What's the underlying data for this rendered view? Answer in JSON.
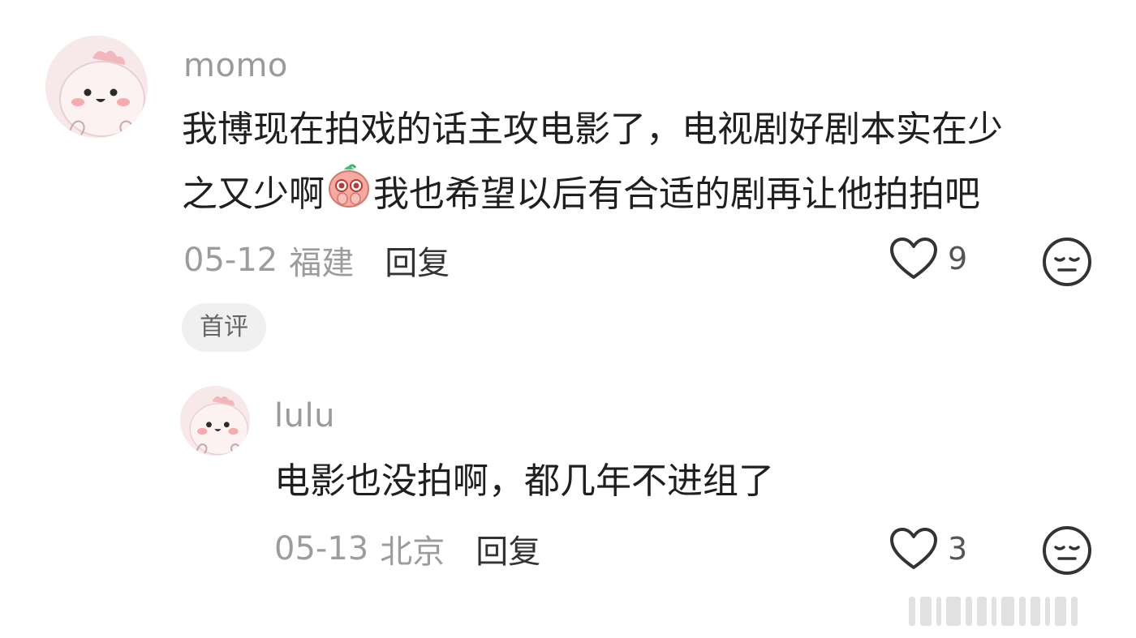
{
  "comment": {
    "username": "momo",
    "content_line1": "我博现在拍戏的话主攻电影了，电视剧好剧本实在少",
    "content_line2_a": "之又少啊",
    "content_line2_b": "我也希望以后有合适的剧再让他拍拍吧",
    "date": "05-12",
    "location": "福建",
    "reply_label": "回复",
    "like_count": "9",
    "badge": "首评"
  },
  "reply": {
    "username": "lulu",
    "content": "电影也没拍啊，都几年不进组了",
    "date": "05-13",
    "location": "北京",
    "reply_label": "回复",
    "like_count": "3"
  },
  "colors": {
    "avatar_bg": "#f7e9ea",
    "avatar_face": "#fdf2f2",
    "avatar_crest": "#f2b7bd",
    "blush": "#f6a9ae",
    "icon_stroke": "#333333"
  }
}
